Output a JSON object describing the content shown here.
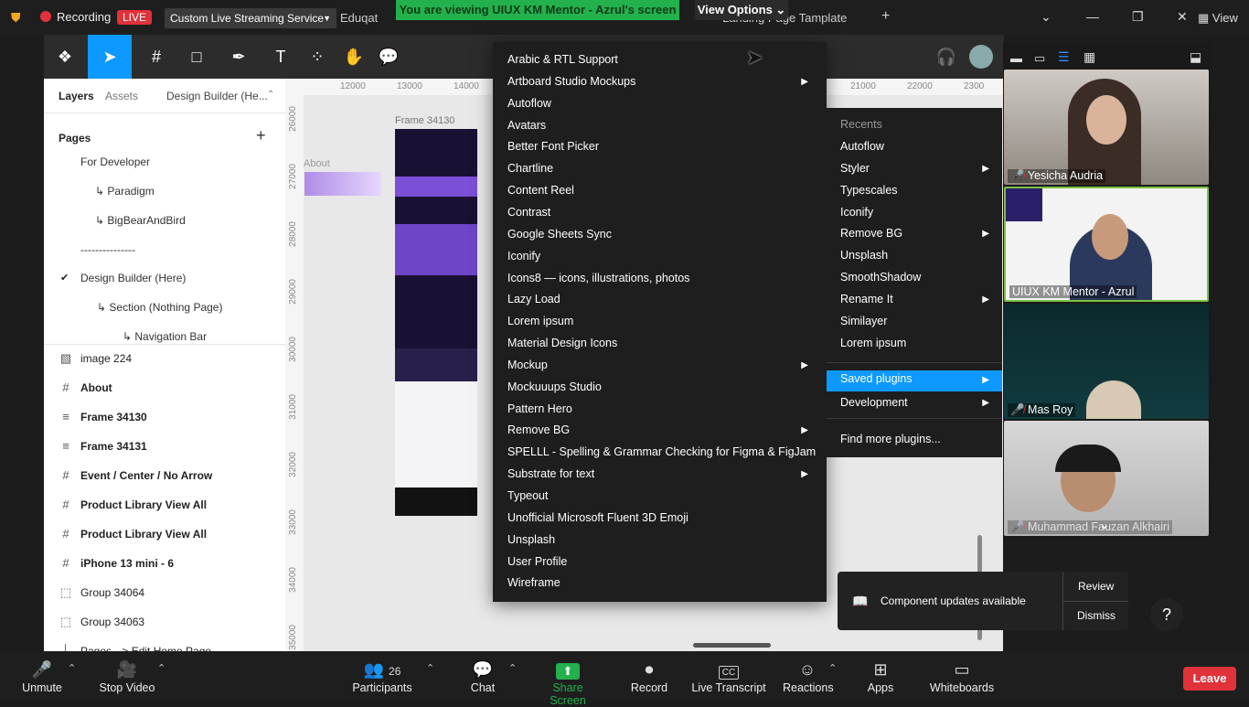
{
  "zoom_top": {
    "recording": "Recording",
    "live": "LIVE",
    "stream": "Custom Live Streaming Service",
    "share_banner": "You are viewing UIUX KM Mentor - Azrul's screen",
    "view_options": "View Options",
    "tabs": [
      "Eduqat",
      "Landing Page Tamplate"
    ],
    "view": "View"
  },
  "left_panel": {
    "tabs": [
      "Layers",
      "Assets",
      "Design Builder (He..."
    ],
    "pages_heading": "Pages",
    "pages": [
      "For Developer",
      "↳ Paradigm",
      "↳ BigBearAndBird",
      "---------------",
      "Design Builder (Here)",
      "↳ Section (Nothing Page)",
      "↳ Navigation Bar"
    ],
    "layers": [
      {
        "icon": "image-icon",
        "label": "image 224"
      },
      {
        "icon": "frame-icon",
        "label": "About"
      },
      {
        "icon": "autolayout-icon",
        "label": "Frame 34130"
      },
      {
        "icon": "autolayout-icon",
        "label": "Frame 34131"
      },
      {
        "icon": "frame-icon",
        "label": "Event / Center / No Arrow"
      },
      {
        "icon": "frame-icon",
        "label": "Product Library View All"
      },
      {
        "icon": "frame-icon",
        "label": "Product Library View All"
      },
      {
        "icon": "frame-icon",
        "label": "iPhone 13 mini - 6"
      },
      {
        "icon": "group-icon",
        "label": "Group 34064"
      },
      {
        "icon": "group-icon",
        "label": "Group 34063"
      },
      {
        "icon": "section-icon",
        "label": "Pages --> Edit Home Page"
      }
    ]
  },
  "canvas": {
    "ruler_x": [
      "12000",
      "13000",
      "14000",
      "21000",
      "22000",
      "2300"
    ],
    "ruler_y": [
      "26000",
      "27000",
      "28000",
      "29000",
      "30000",
      "31000",
      "32000",
      "33000",
      "34000",
      "35000"
    ],
    "frame_label": "Frame 34130",
    "about_label": "About"
  },
  "plugins_menu": [
    {
      "label": "Arabic & RTL Support",
      "sub": false
    },
    {
      "label": "Artboard Studio Mockups",
      "sub": true
    },
    {
      "label": "Autoflow",
      "sub": false
    },
    {
      "label": "Avatars",
      "sub": false
    },
    {
      "label": "Better Font Picker",
      "sub": false
    },
    {
      "label": "Chartline",
      "sub": false
    },
    {
      "label": "Content Reel",
      "sub": false
    },
    {
      "label": "Contrast",
      "sub": false
    },
    {
      "label": "Google Sheets Sync",
      "sub": false
    },
    {
      "label": "Iconify",
      "sub": false
    },
    {
      "label": "Icons8 — icons, illustrations, photos",
      "sub": false
    },
    {
      "label": "Lazy Load",
      "sub": false
    },
    {
      "label": "Lorem ipsum",
      "sub": false
    },
    {
      "label": "Material Design Icons",
      "sub": false
    },
    {
      "label": "Mockup",
      "sub": true
    },
    {
      "label": "Mockuuups Studio",
      "sub": false
    },
    {
      "label": "Pattern Hero",
      "sub": false
    },
    {
      "label": "Remove BG",
      "sub": true
    },
    {
      "label": "SPELLL - Spelling & Grammar Checking for Figma & FigJam",
      "sub": false
    },
    {
      "label": "Substrate for text",
      "sub": true
    },
    {
      "label": "Typeout",
      "sub": false
    },
    {
      "label": "Unofficial Microsoft Fluent 3D Emoji",
      "sub": false
    },
    {
      "label": "Unsplash",
      "sub": false
    },
    {
      "label": "User Profile",
      "sub": false
    },
    {
      "label": "Wireframe",
      "sub": false
    }
  ],
  "plugins_sub": {
    "recents_heading": "Recents",
    "recents": [
      {
        "label": "Autoflow",
        "sub": false
      },
      {
        "label": "Styler",
        "sub": true
      },
      {
        "label": "Typescales",
        "sub": false
      },
      {
        "label": "Iconify",
        "sub": false
      },
      {
        "label": "Remove BG",
        "sub": true
      },
      {
        "label": "Unsplash",
        "sub": false
      },
      {
        "label": "SmoothShadow",
        "sub": false
      },
      {
        "label": "Rename It",
        "sub": true
      },
      {
        "label": "Similayer",
        "sub": false
      },
      {
        "label": "Lorem ipsum",
        "sub": false
      }
    ],
    "saved": "Saved plugins",
    "development": "Development",
    "find_more": "Find more plugins..."
  },
  "videos": [
    {
      "name": "Yesicha Audria",
      "muted": true
    },
    {
      "name": "UIUX KM Mentor - Azrul",
      "muted": false
    },
    {
      "name": "Mas Roy",
      "muted": true
    },
    {
      "name": "Muhammad Fauzan Alkhairi",
      "muted": true
    }
  ],
  "notification": {
    "text": "Component updates available",
    "review": "Review",
    "dismiss": "Dismiss",
    "help": "?"
  },
  "zoom_bottom": {
    "unmute": "Unmute",
    "stop_video": "Stop Video",
    "participants": "Participants",
    "participants_count": "26",
    "chat": "Chat",
    "share_screen": "Share Screen",
    "record": "Record",
    "live_transcript": "Live Transcript",
    "reactions": "Reactions",
    "apps": "Apps",
    "whiteboards": "Whiteboards",
    "leave": "Leave"
  },
  "colors": {
    "figma_blue": "#0d99ff",
    "share_green": "#23b14d",
    "leave_red": "#e0323a"
  }
}
